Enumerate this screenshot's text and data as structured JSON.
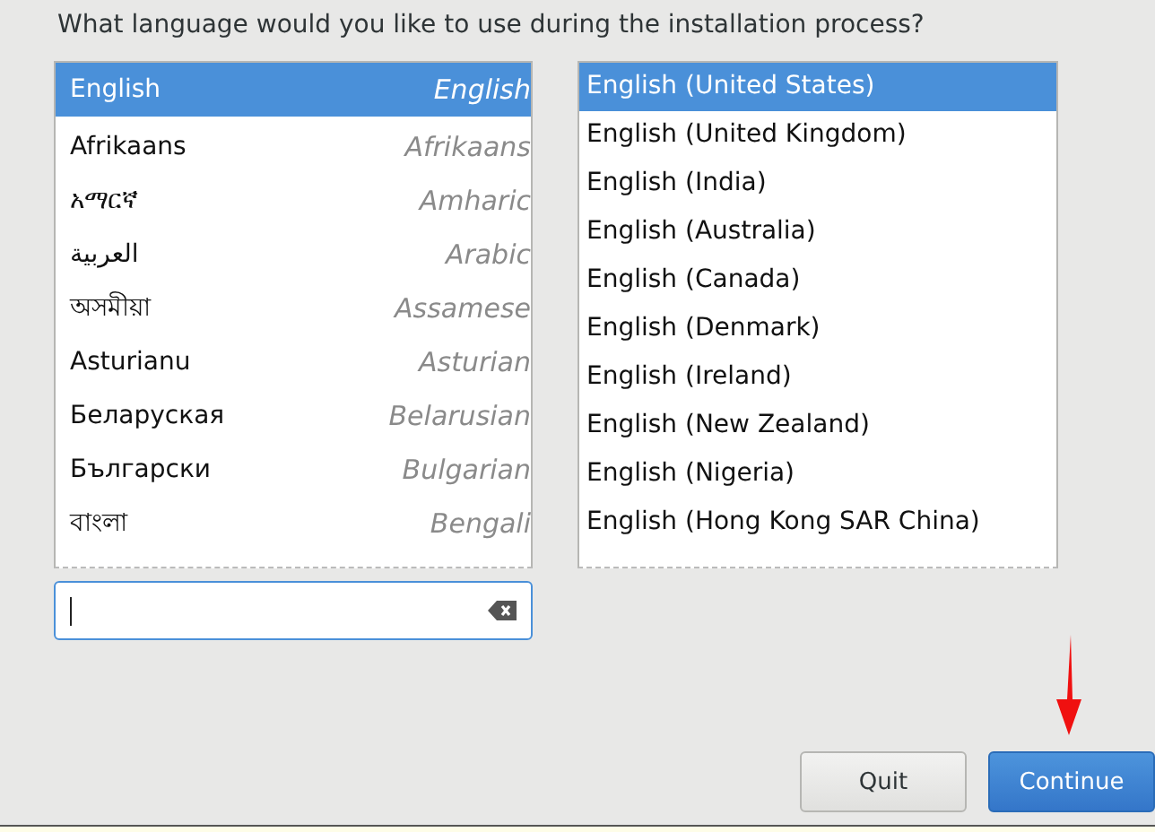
{
  "prompt": "What language would you like to use during the installation process?",
  "languages": [
    {
      "native": "English",
      "english": "English",
      "selected": true
    },
    {
      "native": "Afrikaans",
      "english": "Afrikaans",
      "selected": false
    },
    {
      "native": "አማርኛ",
      "english": "Amharic",
      "selected": false
    },
    {
      "native": "العربية",
      "english": "Arabic",
      "selected": false
    },
    {
      "native": "অসমীয়া",
      "english": "Assamese",
      "selected": false
    },
    {
      "native": "Asturianu",
      "english": "Asturian",
      "selected": false
    },
    {
      "native": "Беларуская",
      "english": "Belarusian",
      "selected": false
    },
    {
      "native": "Български",
      "english": "Bulgarian",
      "selected": false
    },
    {
      "native": "বাংলা",
      "english": "Bengali",
      "selected": false
    }
  ],
  "locales": [
    {
      "label": "English (United States)",
      "selected": true
    },
    {
      "label": "English (United Kingdom)",
      "selected": false
    },
    {
      "label": "English (India)",
      "selected": false
    },
    {
      "label": "English (Australia)",
      "selected": false
    },
    {
      "label": "English (Canada)",
      "selected": false
    },
    {
      "label": "English (Denmark)",
      "selected": false
    },
    {
      "label": "English (Ireland)",
      "selected": false
    },
    {
      "label": "English (New Zealand)",
      "selected": false
    },
    {
      "label": "English (Nigeria)",
      "selected": false
    },
    {
      "label": "English (Hong Kong SAR China)",
      "selected": false
    }
  ],
  "buttons": [
    {
      "label": "Quit",
      "kind": "secondary"
    },
    {
      "label": "Continue",
      "kind": "primary"
    }
  ]
}
